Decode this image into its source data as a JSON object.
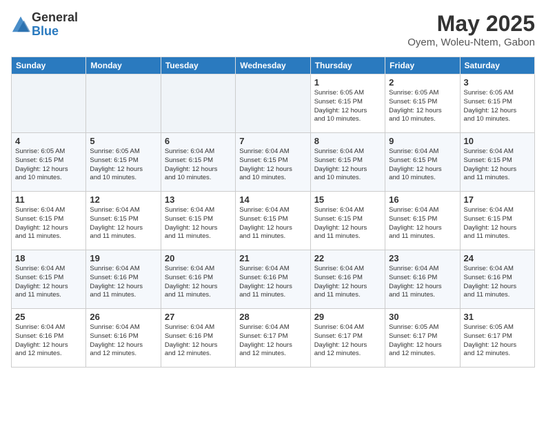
{
  "header": {
    "logo_general": "General",
    "logo_blue": "Blue",
    "month_title": "May 2025",
    "location": "Oyem, Woleu-Ntem, Gabon"
  },
  "weekdays": [
    "Sunday",
    "Monday",
    "Tuesday",
    "Wednesday",
    "Thursday",
    "Friday",
    "Saturday"
  ],
  "weeks": [
    [
      {
        "day": "",
        "info": ""
      },
      {
        "day": "",
        "info": ""
      },
      {
        "day": "",
        "info": ""
      },
      {
        "day": "",
        "info": ""
      },
      {
        "day": "1",
        "info": "Sunrise: 6:05 AM\nSunset: 6:15 PM\nDaylight: 12 hours\nand 10 minutes."
      },
      {
        "day": "2",
        "info": "Sunrise: 6:05 AM\nSunset: 6:15 PM\nDaylight: 12 hours\nand 10 minutes."
      },
      {
        "day": "3",
        "info": "Sunrise: 6:05 AM\nSunset: 6:15 PM\nDaylight: 12 hours\nand 10 minutes."
      }
    ],
    [
      {
        "day": "4",
        "info": "Sunrise: 6:05 AM\nSunset: 6:15 PM\nDaylight: 12 hours\nand 10 minutes."
      },
      {
        "day": "5",
        "info": "Sunrise: 6:05 AM\nSunset: 6:15 PM\nDaylight: 12 hours\nand 10 minutes."
      },
      {
        "day": "6",
        "info": "Sunrise: 6:04 AM\nSunset: 6:15 PM\nDaylight: 12 hours\nand 10 minutes."
      },
      {
        "day": "7",
        "info": "Sunrise: 6:04 AM\nSunset: 6:15 PM\nDaylight: 12 hours\nand 10 minutes."
      },
      {
        "day": "8",
        "info": "Sunrise: 6:04 AM\nSunset: 6:15 PM\nDaylight: 12 hours\nand 10 minutes."
      },
      {
        "day": "9",
        "info": "Sunrise: 6:04 AM\nSunset: 6:15 PM\nDaylight: 12 hours\nand 10 minutes."
      },
      {
        "day": "10",
        "info": "Sunrise: 6:04 AM\nSunset: 6:15 PM\nDaylight: 12 hours\nand 11 minutes."
      }
    ],
    [
      {
        "day": "11",
        "info": "Sunrise: 6:04 AM\nSunset: 6:15 PM\nDaylight: 12 hours\nand 11 minutes."
      },
      {
        "day": "12",
        "info": "Sunrise: 6:04 AM\nSunset: 6:15 PM\nDaylight: 12 hours\nand 11 minutes."
      },
      {
        "day": "13",
        "info": "Sunrise: 6:04 AM\nSunset: 6:15 PM\nDaylight: 12 hours\nand 11 minutes."
      },
      {
        "day": "14",
        "info": "Sunrise: 6:04 AM\nSunset: 6:15 PM\nDaylight: 12 hours\nand 11 minutes."
      },
      {
        "day": "15",
        "info": "Sunrise: 6:04 AM\nSunset: 6:15 PM\nDaylight: 12 hours\nand 11 minutes."
      },
      {
        "day": "16",
        "info": "Sunrise: 6:04 AM\nSunset: 6:15 PM\nDaylight: 12 hours\nand 11 minutes."
      },
      {
        "day": "17",
        "info": "Sunrise: 6:04 AM\nSunset: 6:15 PM\nDaylight: 12 hours\nand 11 minutes."
      }
    ],
    [
      {
        "day": "18",
        "info": "Sunrise: 6:04 AM\nSunset: 6:15 PM\nDaylight: 12 hours\nand 11 minutes."
      },
      {
        "day": "19",
        "info": "Sunrise: 6:04 AM\nSunset: 6:16 PM\nDaylight: 12 hours\nand 11 minutes."
      },
      {
        "day": "20",
        "info": "Sunrise: 6:04 AM\nSunset: 6:16 PM\nDaylight: 12 hours\nand 11 minutes."
      },
      {
        "day": "21",
        "info": "Sunrise: 6:04 AM\nSunset: 6:16 PM\nDaylight: 12 hours\nand 11 minutes."
      },
      {
        "day": "22",
        "info": "Sunrise: 6:04 AM\nSunset: 6:16 PM\nDaylight: 12 hours\nand 11 minutes."
      },
      {
        "day": "23",
        "info": "Sunrise: 6:04 AM\nSunset: 6:16 PM\nDaylight: 12 hours\nand 11 minutes."
      },
      {
        "day": "24",
        "info": "Sunrise: 6:04 AM\nSunset: 6:16 PM\nDaylight: 12 hours\nand 11 minutes."
      }
    ],
    [
      {
        "day": "25",
        "info": "Sunrise: 6:04 AM\nSunset: 6:16 PM\nDaylight: 12 hours\nand 12 minutes."
      },
      {
        "day": "26",
        "info": "Sunrise: 6:04 AM\nSunset: 6:16 PM\nDaylight: 12 hours\nand 12 minutes."
      },
      {
        "day": "27",
        "info": "Sunrise: 6:04 AM\nSunset: 6:16 PM\nDaylight: 12 hours\nand 12 minutes."
      },
      {
        "day": "28",
        "info": "Sunrise: 6:04 AM\nSunset: 6:17 PM\nDaylight: 12 hours\nand 12 minutes."
      },
      {
        "day": "29",
        "info": "Sunrise: 6:04 AM\nSunset: 6:17 PM\nDaylight: 12 hours\nand 12 minutes."
      },
      {
        "day": "30",
        "info": "Sunrise: 6:05 AM\nSunset: 6:17 PM\nDaylight: 12 hours\nand 12 minutes."
      },
      {
        "day": "31",
        "info": "Sunrise: 6:05 AM\nSunset: 6:17 PM\nDaylight: 12 hours\nand 12 minutes."
      }
    ]
  ]
}
